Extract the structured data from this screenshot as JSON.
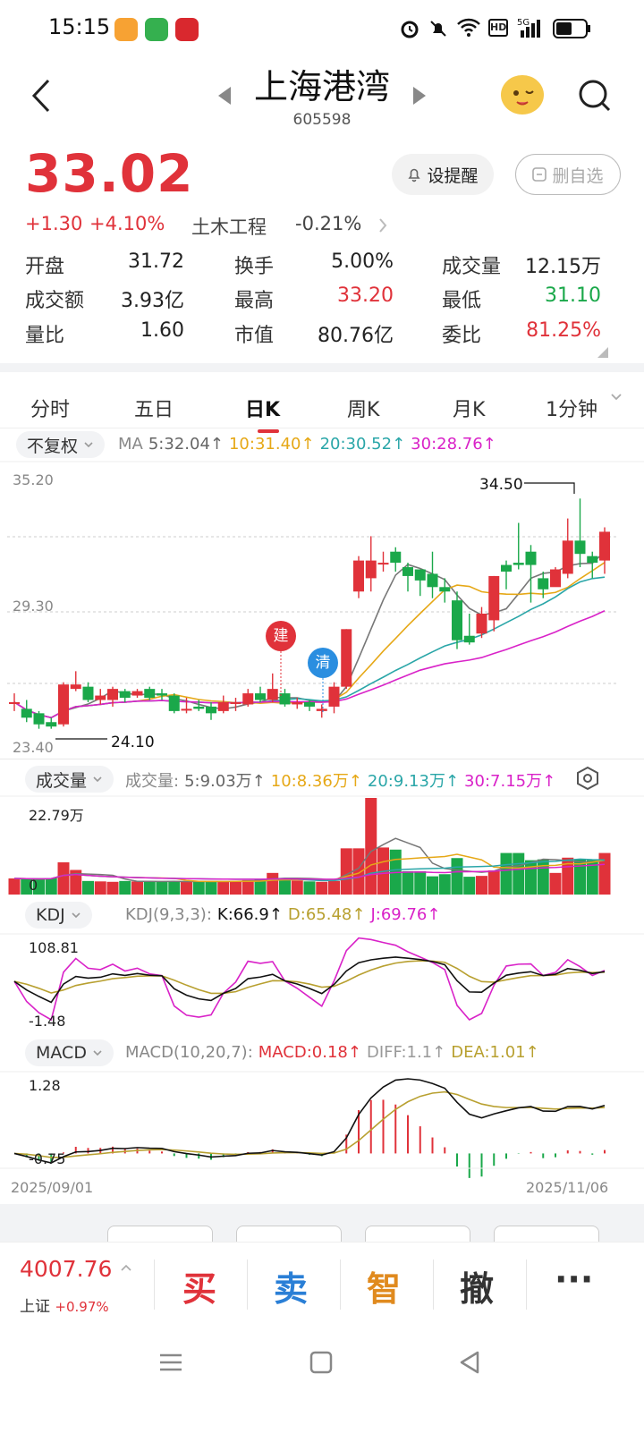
{
  "status_bar": {
    "time": "15:15"
  },
  "header": {
    "title": "上海港湾",
    "code": "605598"
  },
  "quote": {
    "price": "33.02",
    "change": "+1.30",
    "change_pct": "+4.10%",
    "sector_name": "土木工程",
    "sector_pct": "-0.21%",
    "alert_label": "设提醒",
    "remove_label": "删自选"
  },
  "stats": [
    {
      "label": "开盘",
      "value": "31.72",
      "color": "#222222"
    },
    {
      "label": "换手",
      "value": "5.00%",
      "color": "#222222"
    },
    {
      "label": "成交量",
      "value": "12.15万",
      "color": "#222222"
    },
    {
      "label": "成交额",
      "value": "3.93亿",
      "color": "#222222"
    },
    {
      "label": "最高",
      "value": "33.20",
      "color": "#e0323a"
    },
    {
      "label": "最低",
      "value": "31.10",
      "color": "#1aa84a"
    },
    {
      "label": "量比",
      "value": "1.60",
      "color": "#222222"
    },
    {
      "label": "市值",
      "value": "80.76亿",
      "color": "#222222"
    },
    {
      "label": "委比",
      "value": "81.25%",
      "color": "#e0323a"
    }
  ],
  "tabs": [
    "分时",
    "五日",
    "日K",
    "周K",
    "月K",
    "1分钟"
  ],
  "kline": {
    "adjust_label": "不复权",
    "ma_prefix": "MA",
    "ma": [
      {
        "text": "5:32.04↑",
        "color": "#666666"
      },
      {
        "text": "10:31.40↑",
        "color": "#e6a817"
      },
      {
        "text": "20:30.52↑",
        "color": "#2aa6a8"
      },
      {
        "text": "30:28.76↑",
        "color": "#d922c8"
      }
    ],
    "y_top": "35.20",
    "y_mid": "29.30",
    "y_bot": "23.40",
    "hi_label": "34.50",
    "lo_label": "24.10",
    "mark_build": "建",
    "mark_clear": "清"
  },
  "volume": {
    "label": "成交量",
    "prefix": "成交量:",
    "items": [
      {
        "text": "5:9.03万↑",
        "color": "#666666"
      },
      {
        "text": "10:8.36万↑",
        "color": "#e6a817"
      },
      {
        "text": "20:9.13万↑",
        "color": "#2aa6a8"
      },
      {
        "text": "30:7.15万↑",
        "color": "#d922c8"
      }
    ],
    "y_top": "22.79万",
    "y_bot": "0"
  },
  "kdj": {
    "label": "KDJ",
    "prefix": "KDJ(9,3,3):",
    "items": [
      {
        "text": "K:66.9↑",
        "color": "#111111"
      },
      {
        "text": "D:65.48↑",
        "color": "#b8a030"
      },
      {
        "text": "J:69.76↑",
        "color": "#d922c8"
      }
    ],
    "y_top": "108.81",
    "y_bot": "-1.48"
  },
  "macd": {
    "label": "MACD",
    "prefix": "MACD(10,20,7):",
    "items": [
      {
        "text": "MACD:0.18↑",
        "color": "#e0323a"
      },
      {
        "text": "DIFF:1.1↑",
        "color": "#999999"
      },
      {
        "text": "DEA:1.01↑",
        "color": "#b8a030"
      }
    ],
    "y_top": "1.28",
    "y_bot": "-0.75"
  },
  "dates": {
    "start": "2025/09/01",
    "end": "2025/11/06"
  },
  "index": {
    "value": "4007.76",
    "name": "上证",
    "pct": "+0.97%"
  },
  "actions": [
    {
      "label": "买",
      "color": "#e0323a"
    },
    {
      "label": "卖",
      "color": "#2a7fd6"
    },
    {
      "label": "智",
      "color": "#e08a1e"
    },
    {
      "label": "撤",
      "color": "#333333"
    }
  ],
  "more": "···",
  "colors": {
    "up": "#e0323a",
    "down": "#1aa84a"
  },
  "chart_data": {
    "type": "candlestick",
    "y_range": [
      23.4,
      35.2
    ],
    "candles": [
      [
        25.3,
        25.3,
        25.7,
        24.9
      ],
      [
        25.0,
        24.6,
        25.4,
        24.4
      ],
      [
        24.8,
        24.3,
        24.9,
        24.1
      ],
      [
        24.4,
        24.2,
        24.6,
        24.1
      ],
      [
        24.3,
        26.1,
        26.2,
        24.2
      ],
      [
        25.9,
        26.1,
        26.7,
        25.8
      ],
      [
        26.0,
        25.4,
        26.2,
        25.3
      ],
      [
        25.4,
        25.6,
        25.9,
        25.2
      ],
      [
        25.4,
        25.9,
        26.0,
        25.1
      ],
      [
        25.8,
        25.5,
        25.9,
        25.3
      ],
      [
        25.6,
        25.8,
        25.9,
        25.5
      ],
      [
        25.9,
        25.5,
        26.0,
        25.4
      ],
      [
        25.7,
        25.6,
        25.9,
        25.4
      ],
      [
        25.6,
        24.9,
        25.7,
        24.8
      ],
      [
        25.0,
        25.0,
        25.5,
        24.8
      ],
      [
        25.1,
        25.0,
        25.4,
        24.9
      ],
      [
        25.1,
        24.8,
        25.3,
        24.5
      ],
      [
        24.9,
        25.3,
        25.6,
        24.8
      ],
      [
        25.3,
        25.3,
        25.5,
        24.9
      ],
      [
        25.2,
        25.7,
        25.9,
        25.1
      ],
      [
        25.7,
        25.4,
        26.0,
        25.3
      ],
      [
        25.4,
        25.9,
        26.6,
        25.3
      ],
      [
        25.7,
        25.2,
        25.9,
        25.1
      ],
      [
        25.2,
        25.3,
        25.5,
        25.0
      ],
      [
        25.3,
        25.1,
        25.4,
        24.9
      ],
      [
        24.9,
        25.0,
        25.2,
        24.6
      ],
      [
        25.1,
        26.0,
        26.2,
        24.8
      ],
      [
        26.0,
        28.6,
        28.6,
        25.9
      ],
      [
        30.3,
        31.7,
        31.9,
        30.0
      ],
      [
        30.9,
        31.7,
        32.8,
        30.3
      ],
      [
        31.6,
        31.6,
        32.1,
        31.2
      ],
      [
        32.1,
        31.6,
        32.3,
        31.2
      ],
      [
        31.4,
        31.0,
        31.6,
        30.3
      ],
      [
        31.3,
        30.8,
        31.3,
        30.1
      ],
      [
        31.1,
        30.5,
        32.1,
        30.0
      ],
      [
        30.5,
        30.3,
        30.9,
        29.8
      ],
      [
        29.9,
        28.1,
        30.3,
        27.7
      ],
      [
        28.3,
        28.0,
        29.3,
        27.9
      ],
      [
        28.4,
        29.3,
        29.6,
        28.2
      ],
      [
        29.0,
        31.0,
        31.0,
        28.5
      ],
      [
        31.5,
        31.2,
        31.7,
        30.4
      ],
      [
        31.6,
        31.5,
        33.4,
        31.3
      ],
      [
        32.1,
        31.5,
        32.4,
        29.8
      ],
      [
        30.9,
        30.4,
        31.2,
        30.0
      ],
      [
        30.5,
        31.3,
        31.4,
        30.7
      ],
      [
        31.1,
        32.6,
        33.6,
        30.9
      ],
      [
        32.6,
        32.0,
        34.5,
        31.4
      ],
      [
        31.9,
        31.6,
        32.1,
        30.9
      ],
      [
        31.7,
        33.0,
        33.2,
        31.1
      ]
    ],
    "volume_range": [
      0,
      22.79
    ],
    "volumes": [
      3.8,
      3.7,
      3.6,
      3.9,
      7.6,
      5.8,
      3.2,
      3.1,
      3.0,
      3.2,
      3.1,
      3.1,
      3.0,
      3.1,
      3.0,
      3.2,
      3.1,
      3.0,
      3.2,
      3.4,
      3.6,
      5.1,
      3.9,
      3.3,
      3.1,
      3.0,
      3.2,
      10.9,
      10.9,
      22.79,
      11.1,
      10.6,
      5.5,
      5.5,
      4.3,
      4.8,
      8.6,
      4.2,
      4.4,
      5.7,
      9.8,
      9.8,
      8.1,
      8.3,
      5.1,
      8.7,
      8.3,
      8.1,
      9.8
    ]
  }
}
